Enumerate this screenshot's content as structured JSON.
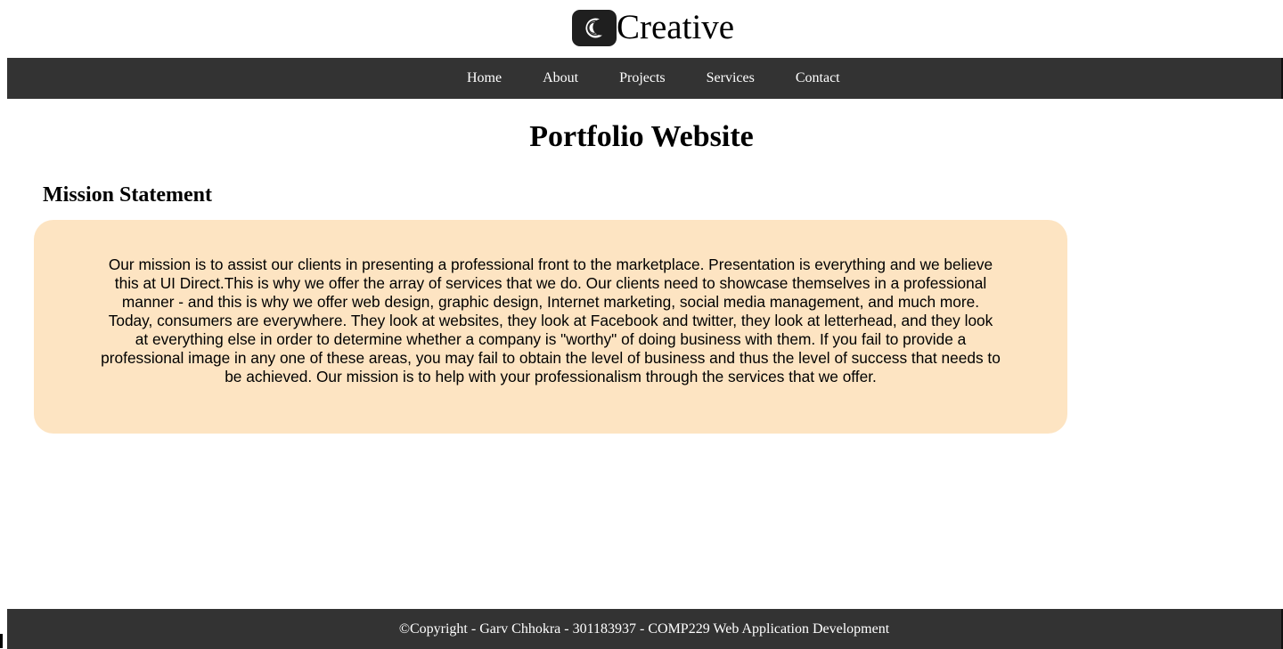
{
  "brand": {
    "name": "Creative",
    "logo_icon": "crescent-c-logo-icon"
  },
  "nav": {
    "items": [
      {
        "label": "Home"
      },
      {
        "label": "About"
      },
      {
        "label": "Projects"
      },
      {
        "label": "Services"
      },
      {
        "label": "Contact"
      }
    ]
  },
  "main": {
    "title": "Portfolio Website",
    "section_title": "Mission Statement",
    "mission_text": "Our mission is to assist our clients in presenting a professional front to the marketplace. Presentation is everything and we believe this at UI Direct.This is why we offer the array of services that we do. Our clients need to showcase themselves in a professional manner - and this is why we offer web design, graphic design, Internet marketing, social media management, and much more. Today, consumers are everywhere. They look at websites, they look at Facebook and twitter, they look at letterhead, and they look at everything else in order to determine whether a company is \"worthy\" of doing business with them. If you fail to provide a professional image in any one of these areas, you may fail to obtain the level of business and thus the level of success that needs to be achieved. Our mission is to help with your professionalism through the services that we offer."
  },
  "footer": {
    "text": "©Copyright - Garv Chhokra - 301183937 - COMP229 Web Application Development"
  },
  "colors": {
    "nav_bg": "#333333",
    "mission_bg": "#fde4c2",
    "logo_bg": "#1f1f1f"
  }
}
